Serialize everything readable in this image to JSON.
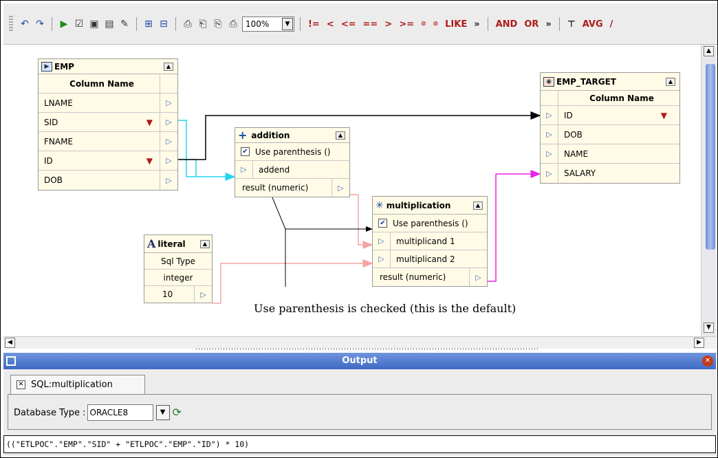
{
  "toolbar": {
    "zoom": "100%",
    "operators": [
      "!=",
      "<",
      "<=",
      "==",
      ">",
      ">=",
      "LIKE",
      "AND",
      "OR",
      "AVG"
    ]
  },
  "emp": {
    "title": "EMP",
    "column_header": "Column Name",
    "rows": [
      "LNAME",
      "SID",
      "FNAME",
      "ID",
      "DOB"
    ]
  },
  "addition": {
    "title": "addition",
    "use_parenthesis": "Use parenthesis ()",
    "input": "addend",
    "result": "result (numeric)"
  },
  "multiplication": {
    "title": "multiplication",
    "use_parenthesis": "Use parenthesis ()",
    "input1": "multiplicand 1",
    "input2": "multiplicand 2",
    "result": "result (numeric)"
  },
  "literal": {
    "title": "literal",
    "sql_type_label": "Sql Type",
    "sql_type_value": "integer",
    "value": "10"
  },
  "emp_target": {
    "title": "EMP_TARGET",
    "column_header": "Column Name",
    "rows": [
      "ID",
      "DOB",
      "NAME",
      "SALARY"
    ]
  },
  "annotation": "Use parenthesis is checked (this is the default)",
  "output": {
    "title": "Output",
    "tab_label": "SQL:multiplication",
    "db_type_label": "Database Type :",
    "db_type_value": "ORACLE8",
    "sql": "((\"ETLPOC\".\"EMP\".\"SID\" + \"ETLPOC\".\"EMP\".\"ID\") * 10)"
  },
  "colors": {
    "cyan_link": "#22d3f0",
    "pink_link": "#f5a3a3",
    "magenta_link": "#e823e8",
    "title_bar": "#3e6ac4"
  }
}
